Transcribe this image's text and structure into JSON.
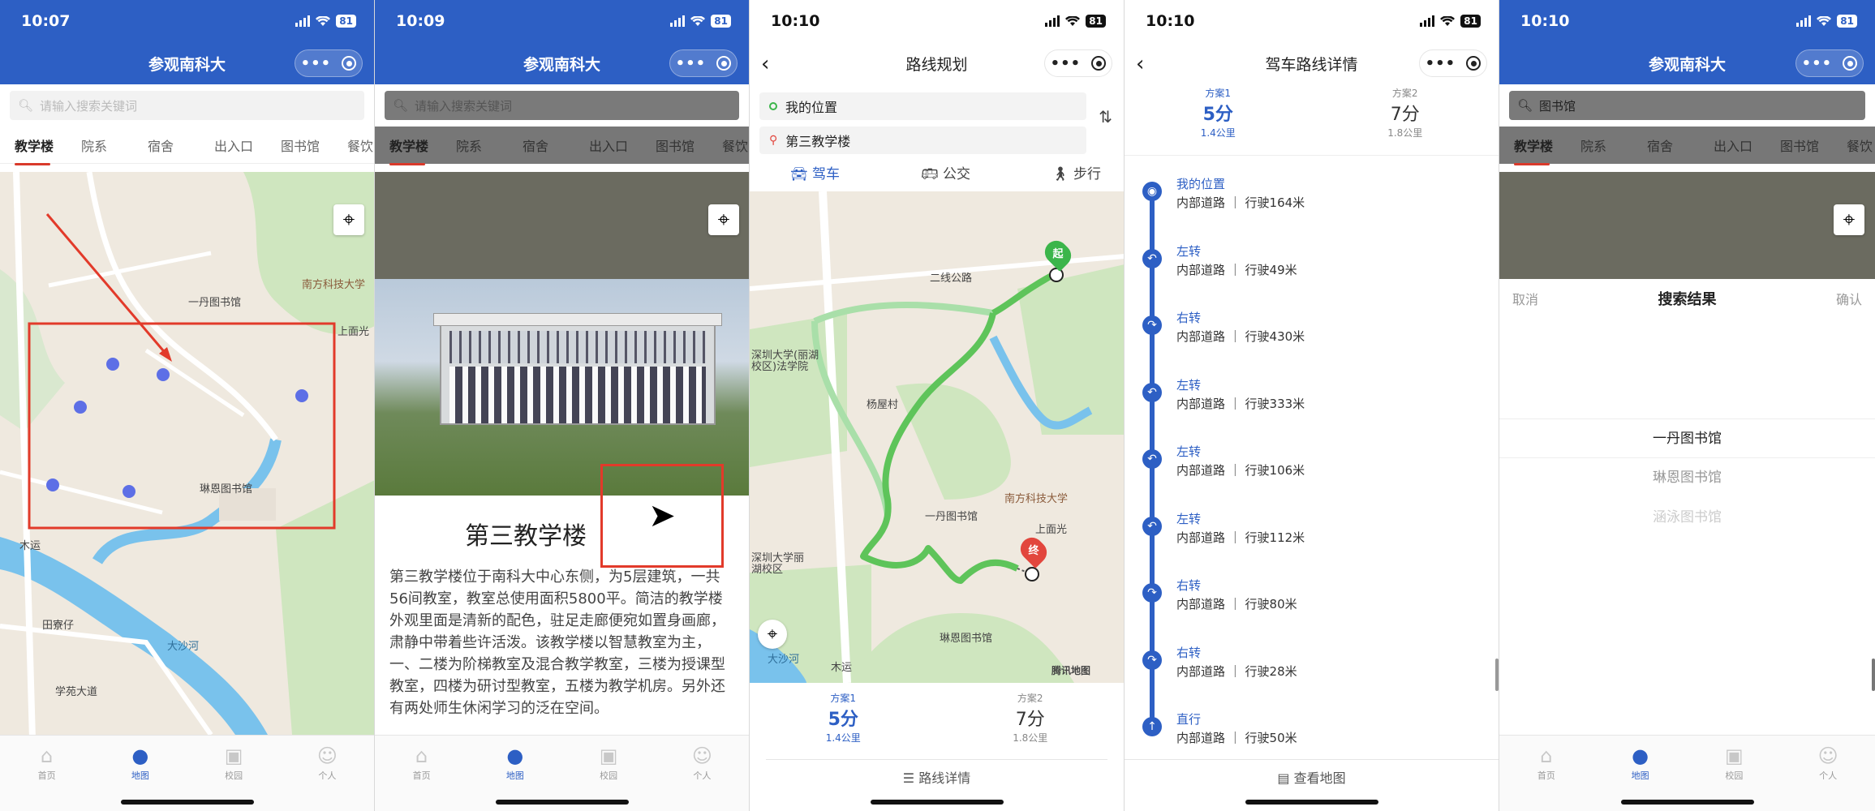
{
  "colors": {
    "brand": "#2d5fc4",
    "accent_red": "#e23a2a",
    "route_green": "#5ec45a"
  },
  "screens": [
    {
      "time": "10:07",
      "battery": "81",
      "title": "参观南科大",
      "search_placeholder": "请输入搜索关键词",
      "tabs": [
        "教学楼",
        "院系",
        "宿舍",
        "出入口",
        "图书馆",
        "餐饮"
      ],
      "map_labels": [
        "南方科技大学",
        "一丹图书馆",
        "上面光",
        "琳恩图书馆",
        "木运",
        "田寮仔",
        "学苑大道",
        "大沙河",
        "南方科技大学"
      ]
    },
    {
      "time": "10:09",
      "battery": "81",
      "title": "参观南科大",
      "search_placeholder": "请输入搜索关键词",
      "tabs": [
        "教学楼",
        "院系",
        "宿舍",
        "出入口",
        "图书馆",
        "餐饮"
      ],
      "building_title": "第三教学楼",
      "description": "第三教学楼位于南科大中心东侧，为5层建筑，一共56间教室，教室总使用面积5800平。简洁的教学楼外观里面是清新的配色，驻足走廊便宛如置身画廊，肃静中带着些许活泼。该教学楼以智慧教室为主，一、二楼为阶梯教室及混合教学教室，三楼为授课型教室，四楼为研讨型教室，五楼为教学机房。另外还有两处师生休闲学习的泛在空间。"
    },
    {
      "time": "10:10",
      "battery": "81",
      "title": "路线规划",
      "from": "我的位置",
      "to": "第三教学楼",
      "modes": [
        "驾车",
        "公交",
        "步行"
      ],
      "start_marker": "起",
      "end_marker": "终",
      "map_labels": [
        "二线公路",
        "深圳大学(丽湖校区)法学院",
        "杨屋村",
        "南方科技大学",
        "一丹图书馆",
        "上面光",
        "深圳大学丽湖校区",
        "琳恩图书馆",
        "大沙河",
        "木运"
      ],
      "watermark": "腾讯地图",
      "plans": [
        {
          "label": "方案1",
          "time": "5分",
          "dist": "1.4公里"
        },
        {
          "label": "方案2",
          "time": "7分",
          "dist": "1.8公里"
        }
      ],
      "detail_link": "路线详情"
    },
    {
      "time": "10:10",
      "battery": "81",
      "title": "驾车路线详情",
      "plans": [
        {
          "label": "方案1",
          "time": "5分",
          "dist": "1.4公里"
        },
        {
          "label": "方案2",
          "time": "7分",
          "dist": "1.8公里"
        }
      ],
      "steps": [
        {
          "action": "我的位置",
          "road": "内部道路 ｜ 行驶164米",
          "icon": "location-icon"
        },
        {
          "action": "左转",
          "road": "内部道路 ｜ 行驶49米",
          "icon": "turn-left-icon"
        },
        {
          "action": "右转",
          "road": "内部道路 ｜ 行驶430米",
          "icon": "turn-right-icon"
        },
        {
          "action": "左转",
          "road": "内部道路 ｜ 行驶333米",
          "icon": "turn-left-icon"
        },
        {
          "action": "左转",
          "road": "内部道路 ｜ 行驶106米",
          "icon": "turn-left-icon"
        },
        {
          "action": "左转",
          "road": "内部道路 ｜ 行驶112米",
          "icon": "turn-left-icon"
        },
        {
          "action": "右转",
          "road": "内部道路 ｜ 行驶80米",
          "icon": "turn-right-icon"
        },
        {
          "action": "右转",
          "road": "内部道路 ｜ 行驶28米",
          "icon": "turn-right-icon"
        },
        {
          "action": "直行",
          "road": "内部道路 ｜ 行驶50米",
          "icon": "straight-icon"
        }
      ],
      "map_link": "查看地图"
    },
    {
      "time": "10:10",
      "battery": "81",
      "title": "参观南科大",
      "search_value": "图书馆",
      "tabs": [
        "教学楼",
        "院系",
        "宿舍",
        "出入口",
        "图书馆",
        "餐饮"
      ],
      "sheet": {
        "cancel": "取消",
        "title": "搜索结果",
        "confirm": "确认"
      },
      "results": [
        "一丹图书馆",
        "琳恩图书馆",
        "涵泳图书馆"
      ]
    }
  ],
  "tabbar": [
    "首页",
    "地图",
    "校园",
    "个人"
  ]
}
